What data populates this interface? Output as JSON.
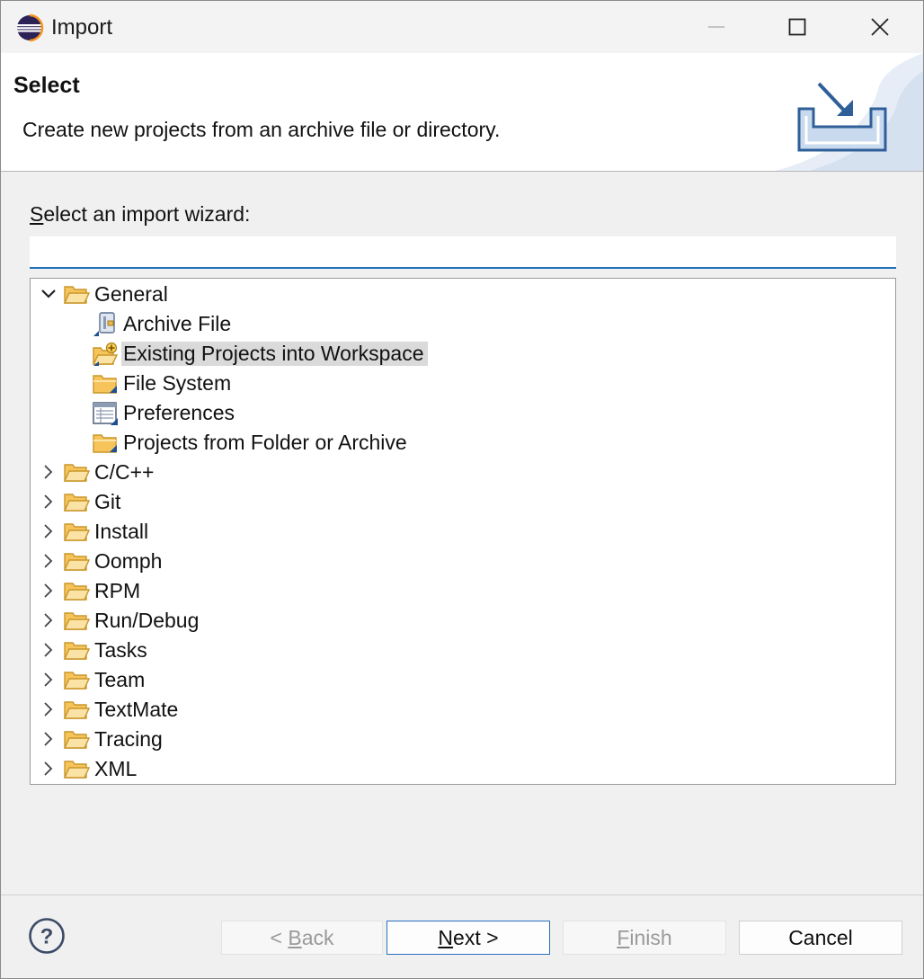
{
  "window": {
    "title": "Import",
    "controls": {
      "minimize": "minimize",
      "maximize": "maximize",
      "close": "close"
    }
  },
  "banner": {
    "title": "Select",
    "description": "Create new projects from an archive file or directory."
  },
  "filter": {
    "label_mnemonic": "S",
    "label_rest": "elect an import wizard:",
    "value": ""
  },
  "tree": {
    "items": [
      {
        "label": "General",
        "expanded": true,
        "icon": "folder-open-icon"
      },
      {
        "label": "Archive File",
        "child": true,
        "icon": "archive-file-icon"
      },
      {
        "label": "Existing Projects into Workspace",
        "child": true,
        "selected": true,
        "icon": "existing-projects-icon"
      },
      {
        "label": "File System",
        "child": true,
        "icon": "folder-icon"
      },
      {
        "label": "Preferences",
        "child": true,
        "icon": "preferences-icon"
      },
      {
        "label": "Projects from Folder or Archive",
        "child": true,
        "icon": "folder-icon"
      },
      {
        "label": "C/C++",
        "expanded": false,
        "icon": "folder-open-icon"
      },
      {
        "label": "Git",
        "expanded": false,
        "icon": "folder-open-icon"
      },
      {
        "label": "Install",
        "expanded": false,
        "icon": "folder-open-icon"
      },
      {
        "label": "Oomph",
        "expanded": false,
        "icon": "folder-open-icon"
      },
      {
        "label": "RPM",
        "expanded": false,
        "icon": "folder-open-icon"
      },
      {
        "label": "Run/Debug",
        "expanded": false,
        "icon": "folder-open-icon"
      },
      {
        "label": "Tasks",
        "expanded": false,
        "icon": "folder-open-icon"
      },
      {
        "label": "Team",
        "expanded": false,
        "icon": "folder-open-icon"
      },
      {
        "label": "TextMate",
        "expanded": false,
        "icon": "folder-open-icon"
      },
      {
        "label": "Tracing",
        "expanded": false,
        "icon": "folder-open-icon"
      },
      {
        "label": "XML",
        "expanded": false,
        "icon": "folder-open-icon"
      }
    ]
  },
  "buttons": {
    "back": {
      "prefix": "< ",
      "mnemonic": "B",
      "rest": "ack",
      "enabled": false
    },
    "next": {
      "mnemonic": "N",
      "rest": "ext >",
      "enabled": true
    },
    "finish": {
      "mnemonic": "F",
      "rest": "inish",
      "enabled": false
    },
    "cancel": {
      "label": "Cancel",
      "enabled": true
    },
    "help": {
      "glyph": "?"
    }
  },
  "colors": {
    "accent": "#1f6fb5",
    "selection": "#dadada",
    "folder": "#f6c45a",
    "folder_stroke": "#c9962a",
    "banner_icon": "#2f5f99"
  }
}
